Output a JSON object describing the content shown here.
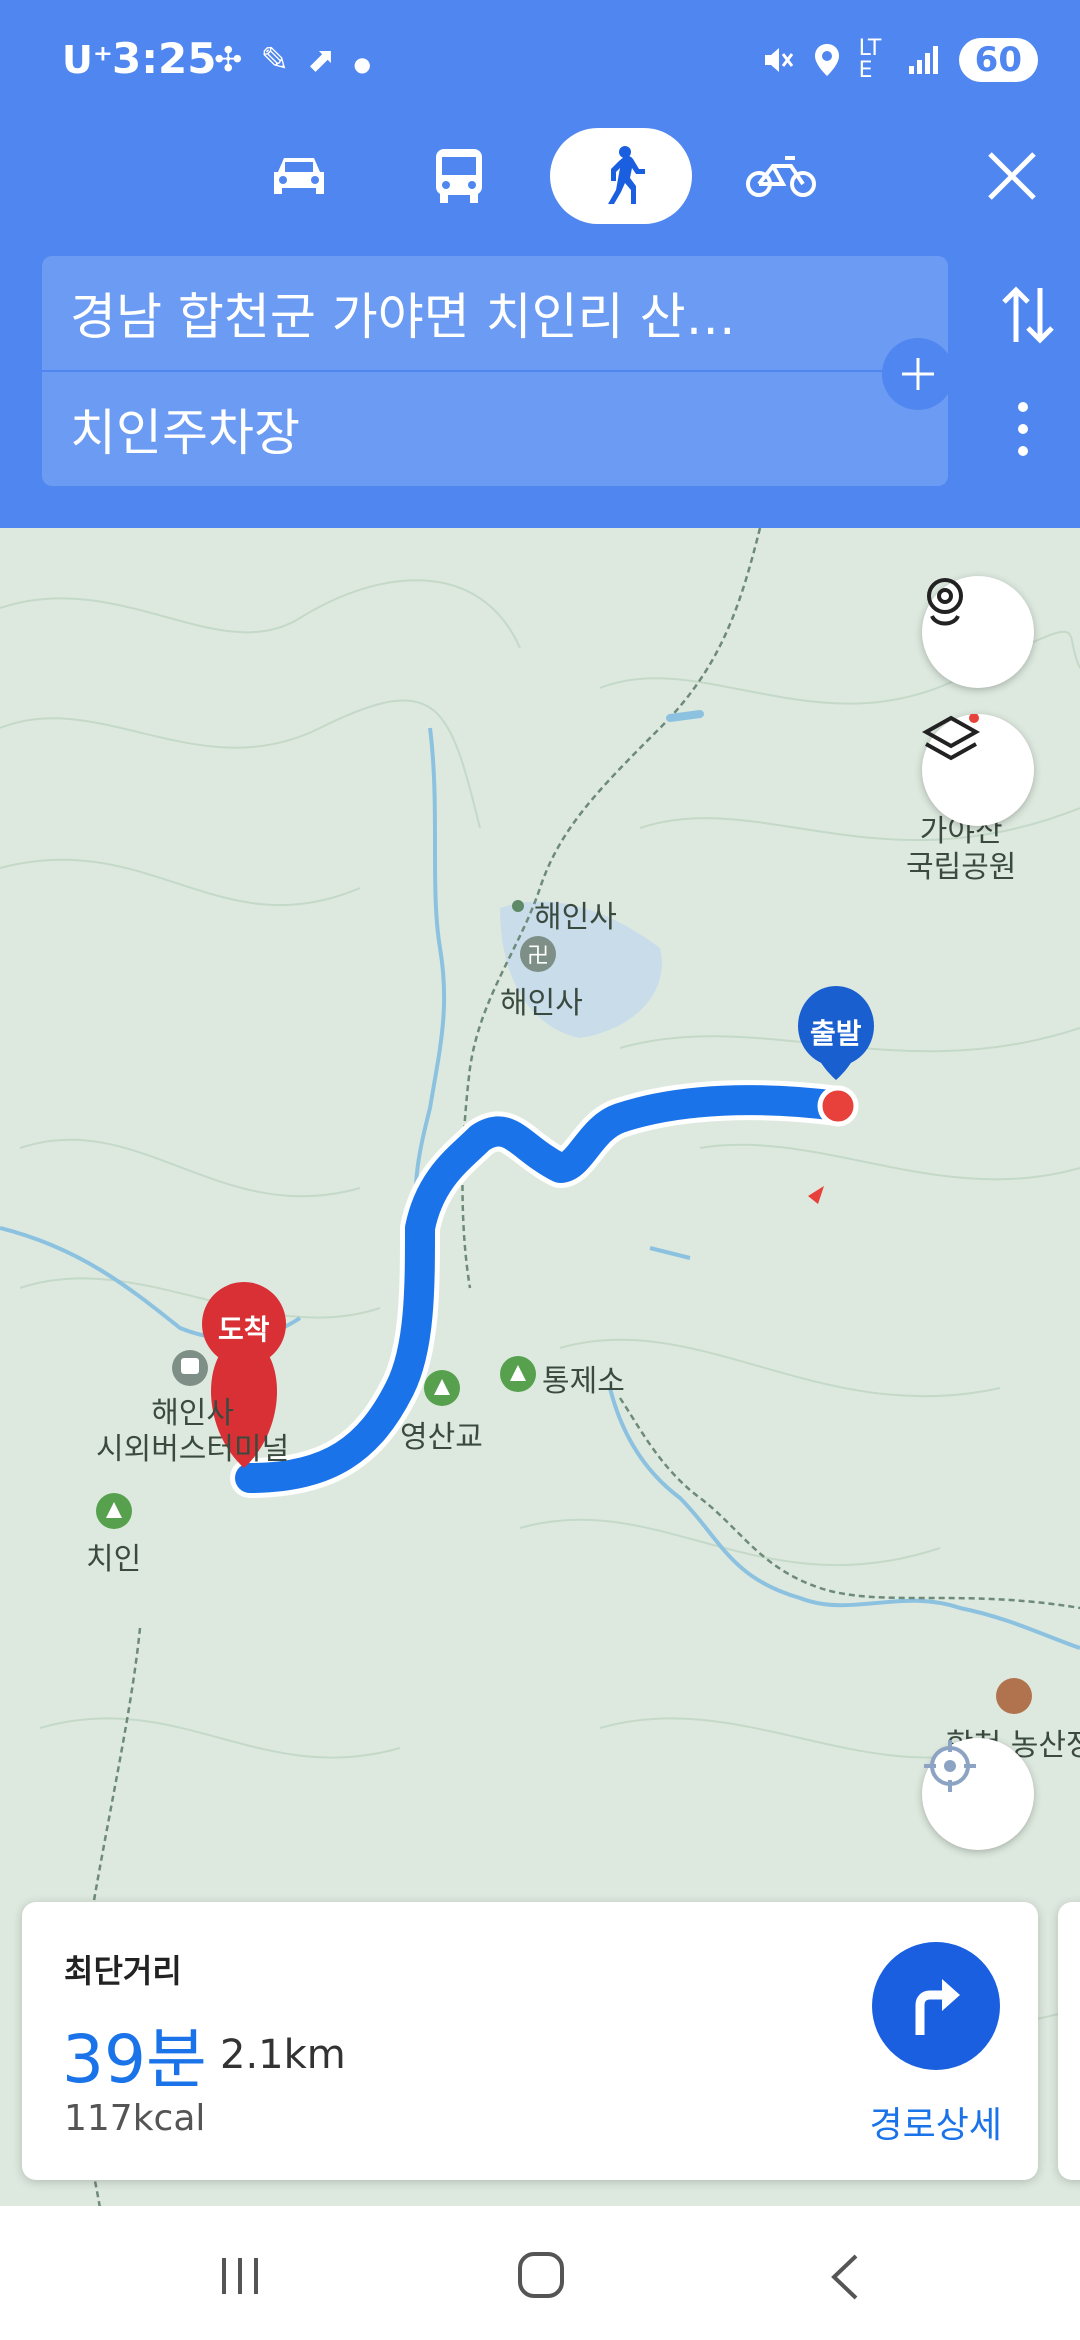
{
  "status_bar": {
    "carrier": "U⁺",
    "time": "3:25",
    "battery": "60",
    "network": "LTE"
  },
  "modes": [
    {
      "name": "car",
      "active": false
    },
    {
      "name": "bus",
      "active": false
    },
    {
      "name": "walk",
      "active": true
    },
    {
      "name": "bicycle",
      "active": false
    }
  ],
  "search": {
    "origin": "경남 합천군 가야면 치인리 산…",
    "destination": "치인주차장"
  },
  "map": {
    "labels": {
      "park": "가야산\n국립공원",
      "temple_dot": "해인사",
      "temple": "해인사",
      "start": "출발",
      "end": "도착",
      "bus_terminal": "해인사\n시외버스터미널",
      "yeongsangyo": "영산교",
      "tongjeso": "통제소",
      "chiin": "치인",
      "hapcheon": "합천 농산정"
    }
  },
  "route_card": {
    "title": "최단거리",
    "time": "39분",
    "distance": "2.1km",
    "calories": "117kcal",
    "detail_label": "경로상세"
  },
  "colors": {
    "header": "#4f86ef",
    "route": "#1a73e8",
    "start_pin": "#1a5fd0",
    "end_pin": "#d93036"
  }
}
